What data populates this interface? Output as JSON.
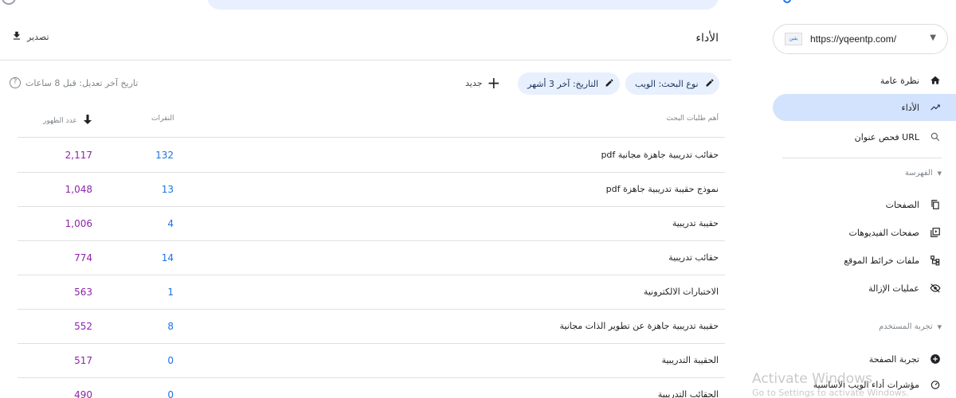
{
  "header": {
    "title": "الأداء",
    "export_label": "تصدير"
  },
  "filters": {
    "search_type": "نوع البحث: الويب",
    "date": "التاريخ: آخر 3 أشهر",
    "new_label": "جديد",
    "last_updated": "تاريخ آخر تعديل: قبل 8 ساعات"
  },
  "table": {
    "columns": {
      "query": "أهم طلبات البحث",
      "clicks": "النقرات",
      "impressions": "عدد الظهور"
    },
    "rows": [
      {
        "query": "حقائب تدريبية جاهزة مجانية pdf",
        "clicks": "132",
        "impressions": "2,117"
      },
      {
        "query": "نموذج حقيبة تدريبية جاهزة pdf",
        "clicks": "13",
        "impressions": "1,048"
      },
      {
        "query": "حقيبة تدريبية",
        "clicks": "4",
        "impressions": "1,006"
      },
      {
        "query": "حقائب تدريبية",
        "clicks": "14",
        "impressions": "774"
      },
      {
        "query": "الاختبارات الالكترونية",
        "clicks": "1",
        "impressions": "563"
      },
      {
        "query": "حقيبة تدريبية جاهزة عن تطوير الذات مجانية",
        "clicks": "8",
        "impressions": "552"
      },
      {
        "query": "الحقيبة التدريبية",
        "clicks": "0",
        "impressions": "517"
      },
      {
        "query": "الحقائب التدريبية",
        "clicks": "0",
        "impressions": "490"
      }
    ]
  },
  "sidebar": {
    "property_url": "https://yqeentp.com/",
    "property_favicon_text": "يقين",
    "overview": "نظرة عامة",
    "performance": "الأداء",
    "url_inspection": "فحص عنوان URL",
    "indexing_section": "الفهرسة",
    "pages": "الصفحات",
    "video_pages": "صفحات الفيديوهات",
    "sitemaps": "ملفات خرائط الموقع",
    "removals": "عمليات الإزالة",
    "experience_section": "تجربة المستخدم",
    "page_experience": "تجربة الصفحة",
    "core_web_vitals": "مؤشرات أداء الويب الأساسية"
  },
  "watermark": {
    "line1": "Activate Windows",
    "line2": "Go to Settings to activate Windows."
  },
  "colors": {
    "accent": "#1a73e8",
    "impressions": "#8e24aa",
    "chip_bg": "#e8f0fe",
    "active_nav_bg": "#d3e3fd"
  }
}
